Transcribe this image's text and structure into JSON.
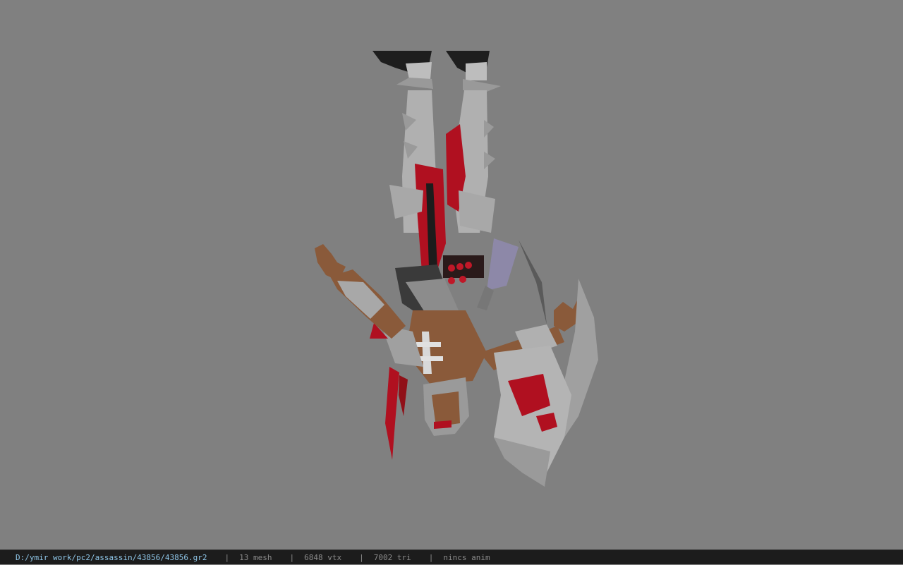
{
  "viewer": {
    "background_color": "#808080",
    "model": {
      "description": "upside-down assassin character model",
      "accent_color": "#b01020",
      "armor_color": "#b8b8b8",
      "skin_color": "#8a5a3a"
    }
  },
  "status_bar": {
    "file_path": "D:/ymir work/pc2/assassin/43856/43856.gr2",
    "separator": "|",
    "mesh_count": "13 mesh",
    "vertex_count": "6848 vtx",
    "triangle_count": "7002 tri",
    "animation_status": "nincs anim",
    "path_color": "#8fc6e8"
  }
}
